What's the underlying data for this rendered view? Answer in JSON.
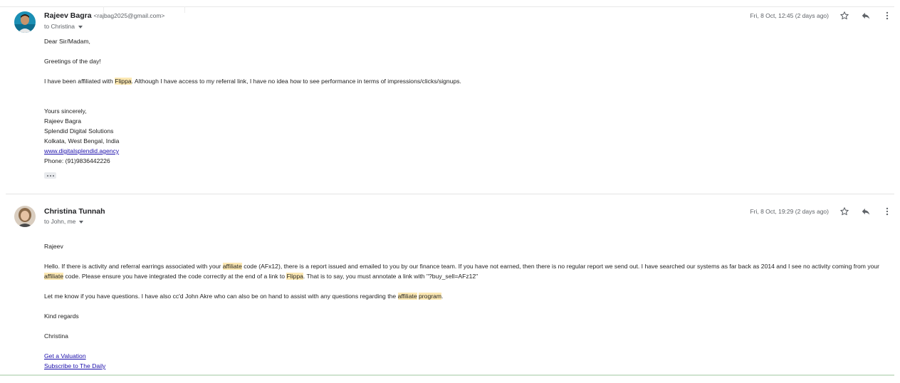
{
  "messages": [
    {
      "sender_name": "Rajeev Bagra",
      "sender_email": "<rajbag2025@gmail.com>",
      "recipient": "to Christina",
      "date": "Fri, 8 Oct, 12:45 (2 days ago)",
      "greeting": "Dear Sir/Madam,",
      "line2": "Greetings of the day!",
      "p1_a": "I have been affiliated with ",
      "p1_hl": "Flippa",
      "p1_b": ". Although I have access to my referral link, I have no idea how to see performance in terms of impressions/clicks/signups.",
      "sig": [
        "Yours sincerely,",
        "Rajeev Bagra",
        "Splendid Digital Solutions",
        "Kolkata, West Bengal, India"
      ],
      "website": "www.digitalsplendid.agency",
      "phone": "Phone: (91)9836442226"
    },
    {
      "sender_name": "Christina Tunnah",
      "recipient": "to John, me",
      "date": "Fri, 8 Oct, 19:29 (2 days ago)",
      "salutation": "Rajeev",
      "p1": [
        "Hello.  If there is activity and referral earrings associated with your ",
        "affiliate",
        " code (AFx12), there is a report issued and emailed to you by our finance team. If you have not earned, then there is no regular report we send out.  I have searched our systems as far back as 2014 and I see no activity coming from your ",
        "affiliate",
        " code. Please ensure you have integrated the code correctly at the end of a link to ",
        "Flippa",
        ".  That is to say, you must annotate a link with \"?buy_sell=AFz12\""
      ],
      "p2": [
        "Let me know if you have questions. I have also cc'd John Akre who can also be on hand to assist with any questions regarding the ",
        "affiliate",
        " ",
        "program",
        "."
      ],
      "closing": "Kind regards",
      "name": "Christina",
      "link1": "Get a Valuation",
      "link2": "Subscribe to The Daily"
    }
  ],
  "colors": {
    "highlight": "#fce8b2",
    "link": "#1a0dab"
  },
  "icons": [
    "star-icon",
    "reply-icon",
    "more-vert-icon"
  ]
}
